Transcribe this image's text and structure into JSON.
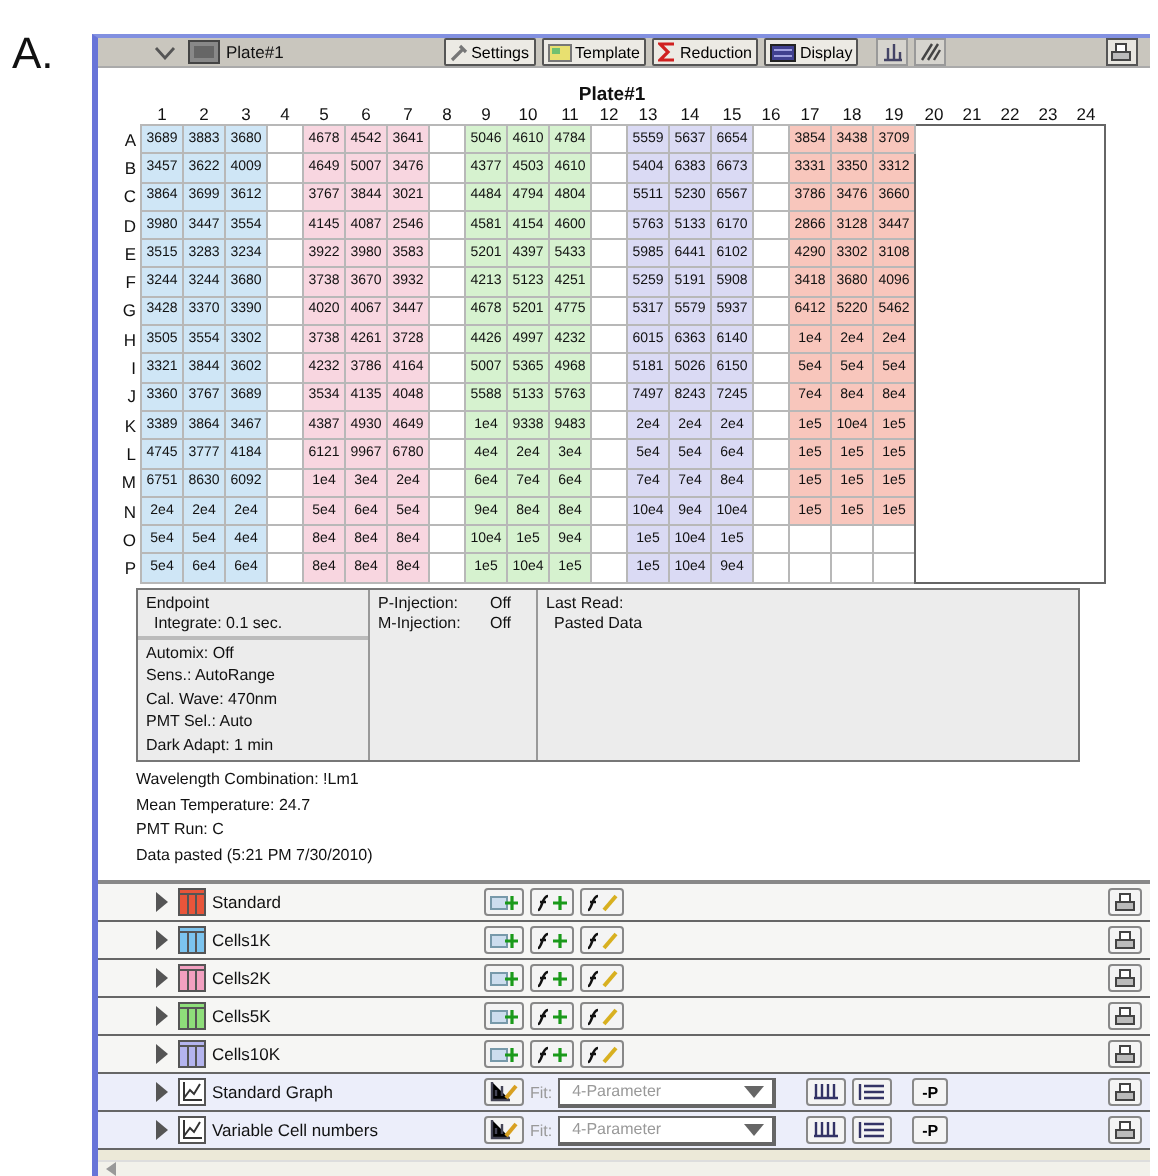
{
  "figure_label": "A.",
  "header": {
    "title": "Plate#1",
    "buttons": [
      {
        "kind": "settings",
        "label": "Settings"
      },
      {
        "kind": "template",
        "label": "Template"
      },
      {
        "kind": "reduction",
        "label": "Reduction"
      },
      {
        "kind": "display",
        "label": "Display"
      }
    ]
  },
  "plate": {
    "title": "Plate#1",
    "columns": [
      "1",
      "2",
      "3",
      "4",
      "5",
      "6",
      "7",
      "8",
      "9",
      "10",
      "11",
      "12",
      "13",
      "14",
      "15",
      "16",
      "17",
      "18",
      "19",
      "20",
      "21",
      "22",
      "23",
      "24"
    ],
    "groups": [
      {
        "color": "#cfe6f6"
      },
      {
        "color": "#f8d6e0"
      },
      {
        "color": "#d6f2cf"
      },
      {
        "color": "#dadaf4"
      },
      {
        "color": "#f8c6bc"
      }
    ],
    "rows": [
      {
        "label": "A",
        "values": [
          [
            "3689",
            "3883",
            "3680"
          ],
          [
            "4678",
            "4542",
            "3641"
          ],
          [
            "5046",
            "4610",
            "4784"
          ],
          [
            "5559",
            "5637",
            "6654"
          ],
          [
            "3854",
            "3438",
            "3709"
          ]
        ]
      },
      {
        "label": "B",
        "values": [
          [
            "3457",
            "3622",
            "4009"
          ],
          [
            "4649",
            "5007",
            "3476"
          ],
          [
            "4377",
            "4503",
            "4610"
          ],
          [
            "5404",
            "6383",
            "6673"
          ],
          [
            "3331",
            "3350",
            "3312"
          ]
        ]
      },
      {
        "label": "C",
        "values": [
          [
            "3864",
            "3699",
            "3612"
          ],
          [
            "3767",
            "3844",
            "3021"
          ],
          [
            "4484",
            "4794",
            "4804"
          ],
          [
            "5511",
            "5230",
            "6567"
          ],
          [
            "3786",
            "3476",
            "3660"
          ]
        ]
      },
      {
        "label": "D",
        "values": [
          [
            "3980",
            "3447",
            "3554"
          ],
          [
            "4145",
            "4087",
            "2546"
          ],
          [
            "4581",
            "4154",
            "4600"
          ],
          [
            "5763",
            "5133",
            "6170"
          ],
          [
            "2866",
            "3128",
            "3447"
          ]
        ]
      },
      {
        "label": "E",
        "values": [
          [
            "3515",
            "3283",
            "3234"
          ],
          [
            "3922",
            "3980",
            "3583"
          ],
          [
            "5201",
            "4397",
            "5433"
          ],
          [
            "5985",
            "6441",
            "6102"
          ],
          [
            "4290",
            "3302",
            "3108"
          ]
        ]
      },
      {
        "label": "F",
        "values": [
          [
            "3244",
            "3244",
            "3680"
          ],
          [
            "3738",
            "3670",
            "3932"
          ],
          [
            "4213",
            "5123",
            "4251"
          ],
          [
            "5259",
            "5191",
            "5908"
          ],
          [
            "3418",
            "3680",
            "4096"
          ]
        ]
      },
      {
        "label": "G",
        "values": [
          [
            "3428",
            "3370",
            "3390"
          ],
          [
            "4020",
            "4067",
            "3447"
          ],
          [
            "4678",
            "5201",
            "4775"
          ],
          [
            "5317",
            "5579",
            "5937"
          ],
          [
            "6412",
            "5220",
            "5462"
          ]
        ]
      },
      {
        "label": "H",
        "values": [
          [
            "3505",
            "3554",
            "3302"
          ],
          [
            "3738",
            "4261",
            "3728"
          ],
          [
            "4426",
            "4997",
            "4232"
          ],
          [
            "6015",
            "6363",
            "6140"
          ],
          [
            "1e4",
            "2e4",
            "2e4"
          ]
        ]
      },
      {
        "label": "I",
        "values": [
          [
            "3321",
            "3844",
            "3602"
          ],
          [
            "4232",
            "3786",
            "4164"
          ],
          [
            "5007",
            "5365",
            "4968"
          ],
          [
            "5181",
            "5026",
            "6150"
          ],
          [
            "5e4",
            "5e4",
            "5e4"
          ]
        ]
      },
      {
        "label": "J",
        "values": [
          [
            "3360",
            "3767",
            "3689"
          ],
          [
            "3534",
            "4135",
            "4048"
          ],
          [
            "5588",
            "5133",
            "5763"
          ],
          [
            "7497",
            "8243",
            "7245"
          ],
          [
            "7e4",
            "8e4",
            "8e4"
          ]
        ]
      },
      {
        "label": "K",
        "values": [
          [
            "3389",
            "3864",
            "3467"
          ],
          [
            "4387",
            "4930",
            "4649"
          ],
          [
            "1e4",
            "9338",
            "9483"
          ],
          [
            "2e4",
            "2e4",
            "2e4"
          ],
          [
            "1e5",
            "10e4",
            "1e5"
          ]
        ]
      },
      {
        "label": "L",
        "values": [
          [
            "4745",
            "3777",
            "4184"
          ],
          [
            "6121",
            "9967",
            "6780"
          ],
          [
            "4e4",
            "2e4",
            "3e4"
          ],
          [
            "5e4",
            "5e4",
            "6e4"
          ],
          [
            "1e5",
            "1e5",
            "1e5"
          ]
        ]
      },
      {
        "label": "M",
        "values": [
          [
            "6751",
            "8630",
            "6092"
          ],
          [
            "1e4",
            "3e4",
            "2e4"
          ],
          [
            "6e4",
            "7e4",
            "6e4"
          ],
          [
            "7e4",
            "7e4",
            "8e4"
          ],
          [
            "1e5",
            "1e5",
            "1e5"
          ]
        ]
      },
      {
        "label": "N",
        "values": [
          [
            "2e4",
            "2e4",
            "2e4"
          ],
          [
            "5e4",
            "6e4",
            "5e4"
          ],
          [
            "9e4",
            "8e4",
            "8e4"
          ],
          [
            "10e4",
            "9e4",
            "10e4"
          ],
          [
            "1e5",
            "1e5",
            "1e5"
          ]
        ]
      },
      {
        "label": "O",
        "values": [
          [
            "5e4",
            "5e4",
            "4e4"
          ],
          [
            "8e4",
            "8e4",
            "8e4"
          ],
          [
            "10e4",
            "1e5",
            "9e4"
          ],
          [
            "1e5",
            "10e4",
            "1e5"
          ]
        ]
      },
      {
        "label": "P",
        "values": [
          [
            "5e4",
            "6e4",
            "6e4"
          ],
          [
            "8e4",
            "8e4",
            "8e4"
          ],
          [
            "1e5",
            "10e4",
            "1e5"
          ],
          [
            "1e5",
            "10e4",
            "9e4"
          ]
        ]
      }
    ]
  },
  "info": {
    "mode": "Endpoint",
    "integrate": "Integrate: 0.1 sec.",
    "settings": [
      "Automix: Off",
      "Sens.: AutoRange",
      "Cal. Wave: 470nm",
      "PMT Sel.: Auto",
      "Dark Adapt: 1 min"
    ],
    "injections": [
      {
        "label": "P-Injection:",
        "value": "Off"
      },
      {
        "label": "M-Injection:",
        "value": "Off"
      }
    ],
    "last_read_label": "Last Read:",
    "last_read": "Pasted Data"
  },
  "notes": [
    "Wavelength Combination: !Lm1",
    "Mean Temperature: 24.7",
    "PMT Run: C",
    "Data pasted (5:21 PM 7/30/2010)"
  ],
  "sections": [
    {
      "kind": "table",
      "name": "Standard",
      "color": "#e8553a"
    },
    {
      "kind": "table",
      "name": "Cells1K",
      "color": "#7cc4ee"
    },
    {
      "kind": "table",
      "name": "Cells2K",
      "color": "#f2a0c0"
    },
    {
      "kind": "table",
      "name": "Cells5K",
      "color": "#8ede7a"
    },
    {
      "kind": "table",
      "name": "Cells10K",
      "color": "#b4b4ee"
    },
    {
      "kind": "graph",
      "name": "Standard Graph",
      "fit_label": "Fit:",
      "fit": "4-Parameter",
      "p_button": "-P"
    },
    {
      "kind": "graph",
      "name": "Variable Cell numbers",
      "fit_label": "Fit:",
      "fit": "4-Parameter",
      "p_button": "-P"
    }
  ]
}
